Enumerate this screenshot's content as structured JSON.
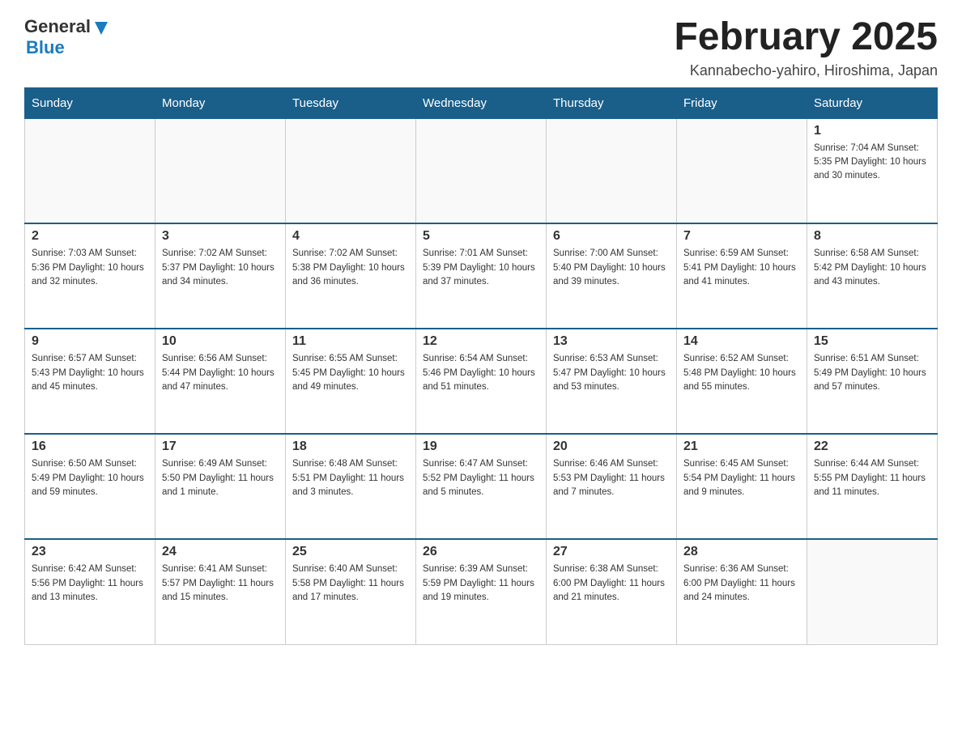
{
  "header": {
    "logo_general": "General",
    "logo_blue": "Blue",
    "title": "February 2025",
    "subtitle": "Kannabecho-yahiro, Hiroshima, Japan"
  },
  "days_of_week": [
    "Sunday",
    "Monday",
    "Tuesday",
    "Wednesday",
    "Thursday",
    "Friday",
    "Saturday"
  ],
  "weeks": [
    [
      {
        "day": "",
        "info": ""
      },
      {
        "day": "",
        "info": ""
      },
      {
        "day": "",
        "info": ""
      },
      {
        "day": "",
        "info": ""
      },
      {
        "day": "",
        "info": ""
      },
      {
        "day": "",
        "info": ""
      },
      {
        "day": "1",
        "info": "Sunrise: 7:04 AM\nSunset: 5:35 PM\nDaylight: 10 hours and 30 minutes."
      }
    ],
    [
      {
        "day": "2",
        "info": "Sunrise: 7:03 AM\nSunset: 5:36 PM\nDaylight: 10 hours and 32 minutes."
      },
      {
        "day": "3",
        "info": "Sunrise: 7:02 AM\nSunset: 5:37 PM\nDaylight: 10 hours and 34 minutes."
      },
      {
        "day": "4",
        "info": "Sunrise: 7:02 AM\nSunset: 5:38 PM\nDaylight: 10 hours and 36 minutes."
      },
      {
        "day": "5",
        "info": "Sunrise: 7:01 AM\nSunset: 5:39 PM\nDaylight: 10 hours and 37 minutes."
      },
      {
        "day": "6",
        "info": "Sunrise: 7:00 AM\nSunset: 5:40 PM\nDaylight: 10 hours and 39 minutes."
      },
      {
        "day": "7",
        "info": "Sunrise: 6:59 AM\nSunset: 5:41 PM\nDaylight: 10 hours and 41 minutes."
      },
      {
        "day": "8",
        "info": "Sunrise: 6:58 AM\nSunset: 5:42 PM\nDaylight: 10 hours and 43 minutes."
      }
    ],
    [
      {
        "day": "9",
        "info": "Sunrise: 6:57 AM\nSunset: 5:43 PM\nDaylight: 10 hours and 45 minutes."
      },
      {
        "day": "10",
        "info": "Sunrise: 6:56 AM\nSunset: 5:44 PM\nDaylight: 10 hours and 47 minutes."
      },
      {
        "day": "11",
        "info": "Sunrise: 6:55 AM\nSunset: 5:45 PM\nDaylight: 10 hours and 49 minutes."
      },
      {
        "day": "12",
        "info": "Sunrise: 6:54 AM\nSunset: 5:46 PM\nDaylight: 10 hours and 51 minutes."
      },
      {
        "day": "13",
        "info": "Sunrise: 6:53 AM\nSunset: 5:47 PM\nDaylight: 10 hours and 53 minutes."
      },
      {
        "day": "14",
        "info": "Sunrise: 6:52 AM\nSunset: 5:48 PM\nDaylight: 10 hours and 55 minutes."
      },
      {
        "day": "15",
        "info": "Sunrise: 6:51 AM\nSunset: 5:49 PM\nDaylight: 10 hours and 57 minutes."
      }
    ],
    [
      {
        "day": "16",
        "info": "Sunrise: 6:50 AM\nSunset: 5:49 PM\nDaylight: 10 hours and 59 minutes."
      },
      {
        "day": "17",
        "info": "Sunrise: 6:49 AM\nSunset: 5:50 PM\nDaylight: 11 hours and 1 minute."
      },
      {
        "day": "18",
        "info": "Sunrise: 6:48 AM\nSunset: 5:51 PM\nDaylight: 11 hours and 3 minutes."
      },
      {
        "day": "19",
        "info": "Sunrise: 6:47 AM\nSunset: 5:52 PM\nDaylight: 11 hours and 5 minutes."
      },
      {
        "day": "20",
        "info": "Sunrise: 6:46 AM\nSunset: 5:53 PM\nDaylight: 11 hours and 7 minutes."
      },
      {
        "day": "21",
        "info": "Sunrise: 6:45 AM\nSunset: 5:54 PM\nDaylight: 11 hours and 9 minutes."
      },
      {
        "day": "22",
        "info": "Sunrise: 6:44 AM\nSunset: 5:55 PM\nDaylight: 11 hours and 11 minutes."
      }
    ],
    [
      {
        "day": "23",
        "info": "Sunrise: 6:42 AM\nSunset: 5:56 PM\nDaylight: 11 hours and 13 minutes."
      },
      {
        "day": "24",
        "info": "Sunrise: 6:41 AM\nSunset: 5:57 PM\nDaylight: 11 hours and 15 minutes."
      },
      {
        "day": "25",
        "info": "Sunrise: 6:40 AM\nSunset: 5:58 PM\nDaylight: 11 hours and 17 minutes."
      },
      {
        "day": "26",
        "info": "Sunrise: 6:39 AM\nSunset: 5:59 PM\nDaylight: 11 hours and 19 minutes."
      },
      {
        "day": "27",
        "info": "Sunrise: 6:38 AM\nSunset: 6:00 PM\nDaylight: 11 hours and 21 minutes."
      },
      {
        "day": "28",
        "info": "Sunrise: 6:36 AM\nSunset: 6:00 PM\nDaylight: 11 hours and 24 minutes."
      },
      {
        "day": "",
        "info": ""
      }
    ]
  ]
}
